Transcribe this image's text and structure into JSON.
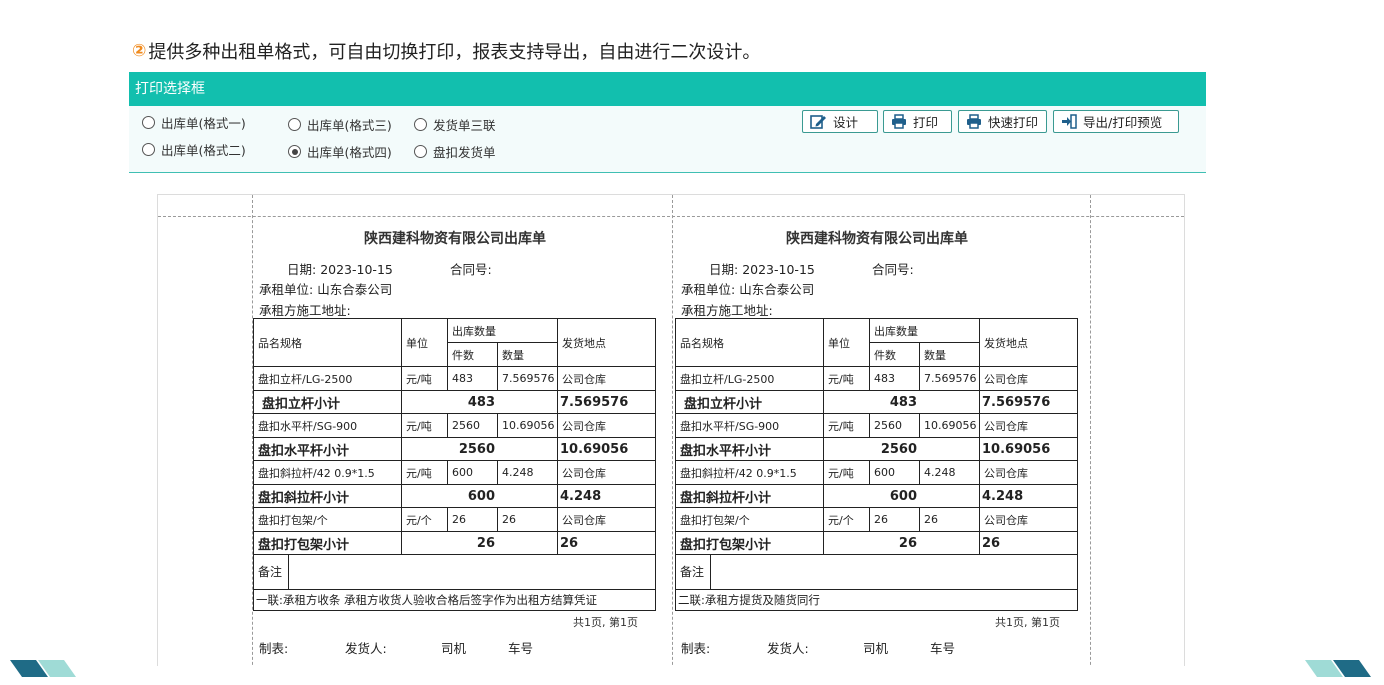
{
  "heading": {
    "num": "②",
    "text": "提供多种出租单格式，可自由切换打印，报表支持导出，自由进行二次设计。"
  },
  "dialog": {
    "title": "打印选择框",
    "radios": [
      {
        "label": "出库单(格式一)",
        "checked": false
      },
      {
        "label": "出库单(格式二)",
        "checked": false
      },
      {
        "label": "出库单(格式三)",
        "checked": false
      },
      {
        "label": "出库单(格式四)",
        "checked": true
      },
      {
        "label": "发货单三联",
        "checked": false
      },
      {
        "label": "盘扣发货单",
        "checked": false
      }
    ],
    "buttons": {
      "design": "设计",
      "print": "打印",
      "quick_print": "快速打印",
      "export": "导出/打印预览"
    }
  },
  "slip": {
    "title": "陕西建科物资有限公司出库单",
    "date_label": "日期:",
    "date": "2023-10-15",
    "contract_label": "合同号:",
    "lessee_label": "承租单位:",
    "lessee": "山东合泰公司",
    "site_label": "承租方施工地址:",
    "headers": {
      "name": "品名规格",
      "unit": "单位",
      "qty_group": "出库数量",
      "pieces": "件数",
      "quantity": "数量",
      "location": "发货地点"
    },
    "rows": [
      {
        "name": "盘扣立杆/LG-2500",
        "unit": "元/吨",
        "pieces": "483",
        "quantity": "7.569576",
        "location": "公司仓库",
        "subtotal_label": "盘扣立杆小计",
        "subtotal_pieces": "483",
        "subtotal_qty": "7.569576"
      },
      {
        "name": "盘扣水平杆/SG-900",
        "unit": "元/吨",
        "pieces": "2560",
        "quantity": "10.69056",
        "location": "公司仓库",
        "subtotal_label": "盘扣水平杆小计",
        "subtotal_pieces": "2560",
        "subtotal_qty": "10.69056"
      },
      {
        "name": "盘扣斜拉杆/42  0.9*1.5",
        "unit": "元/吨",
        "pieces": "600",
        "quantity": "4.248",
        "location": "公司仓库",
        "subtotal_label": "盘扣斜拉杆小计",
        "subtotal_pieces": "600",
        "subtotal_qty": "4.248"
      },
      {
        "name": "盘扣打包架/个",
        "unit": "元/个",
        "pieces": "26",
        "quantity": "26",
        "location": "公司仓库",
        "subtotal_label": "盘扣打包架小计",
        "subtotal_pieces": "26",
        "subtotal_qty": "26"
      }
    ],
    "note_label": "备注",
    "copy1": "一联:承租方收条 承租方收货人验收合格后签字作为出租方结算凭证",
    "copy2": "二联:承租方提货及随货同行",
    "page_info": "共1页, 第1页",
    "sign": {
      "maker": "制表:",
      "shipper": "发货人:",
      "driver": "司机",
      "plate": "车号"
    }
  },
  "colors": {
    "accent": "#12bfae",
    "heading_num": "#f08a1d"
  }
}
